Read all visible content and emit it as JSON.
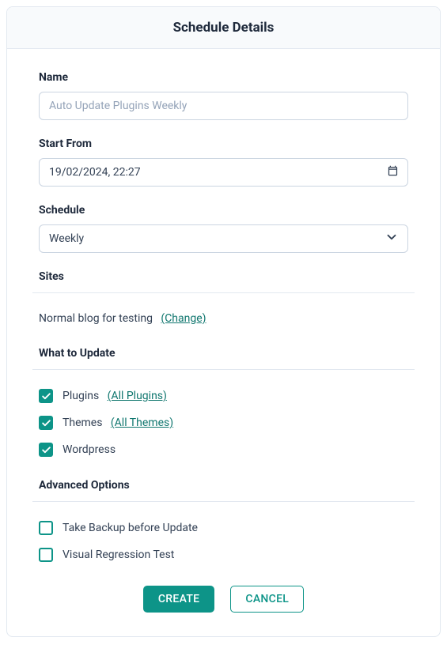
{
  "header": {
    "title": "Schedule Details"
  },
  "form": {
    "name": {
      "label": "Name",
      "placeholder": "Auto Update Plugins Weekly",
      "value": ""
    },
    "startFrom": {
      "label": "Start From",
      "value": "19/02/2024, 22:27"
    },
    "schedule": {
      "label": "Schedule",
      "selected": "Weekly"
    }
  },
  "sites": {
    "label": "Sites",
    "text": "Normal blog for testing",
    "changeLink": "(Change)"
  },
  "whatToUpdate": {
    "label": "What to Update",
    "items": [
      {
        "label": "Plugins",
        "link": "(All Plugins)",
        "checked": true
      },
      {
        "label": "Themes",
        "link": "(All Themes)",
        "checked": true
      },
      {
        "label": "Wordpress",
        "link": "",
        "checked": true
      }
    ]
  },
  "advancedOptions": {
    "label": "Advanced Options",
    "items": [
      {
        "label": "Take Backup before Update",
        "checked": false
      },
      {
        "label": "Visual Regression Test",
        "checked": false
      }
    ]
  },
  "buttons": {
    "create": "CREATE",
    "cancel": "CANCEL"
  }
}
